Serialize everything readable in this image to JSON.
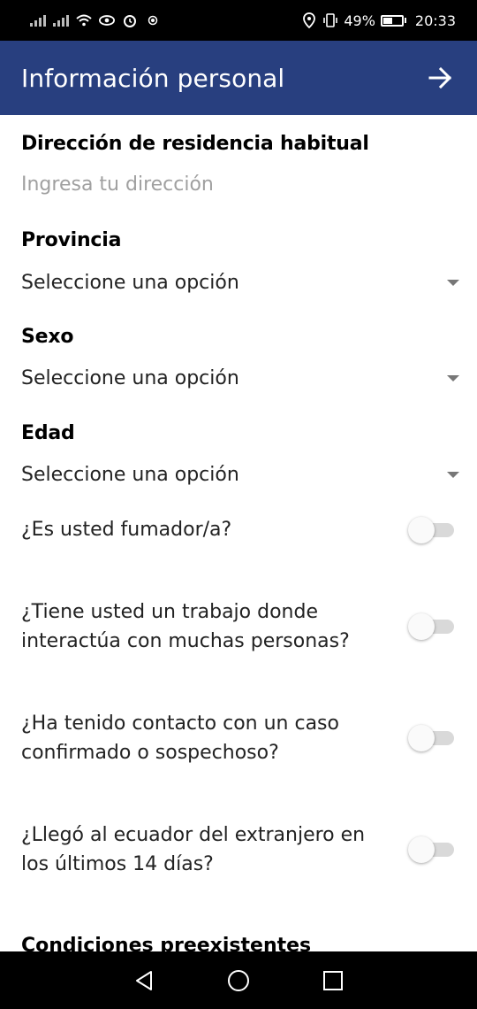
{
  "status_bar": {
    "battery": "49%",
    "time": "20:33",
    "icons": [
      "signal-icon",
      "signal-2-icon",
      "wifi-icon",
      "eye-icon",
      "alarm-icon",
      "sensor-icon",
      "location-icon",
      "vibrate-icon",
      "battery-icon"
    ]
  },
  "app_bar": {
    "title": "Información personal",
    "action_icon": "arrow-right-icon",
    "color": "#283f7f"
  },
  "form": {
    "address": {
      "label": "Dirección de residencia habitual",
      "placeholder": "Ingresa tu dirección",
      "value": ""
    },
    "province": {
      "label": "Provincia",
      "value": "Seleccione una opción"
    },
    "sex": {
      "label": "Sexo",
      "value": "Seleccione una opción"
    },
    "age": {
      "label": "Edad",
      "value": "Seleccione una opción"
    },
    "questions": [
      {
        "text": "¿Es usted fumador/a?",
        "checked": false
      },
      {
        "text": "¿Tiene usted un trabajo donde interactúa con muchas personas?",
        "checked": false
      },
      {
        "text": "¿Ha tenido contacto con un caso confirmado o sospechoso?",
        "checked": false
      },
      {
        "text": "¿Llegó al ecuador del extranjero en los últimos 14 días?",
        "checked": false
      }
    ],
    "next_section": "Condiciones preexistentes"
  },
  "nav_bar": {
    "icons": [
      "back-icon",
      "home-icon",
      "recents-icon"
    ]
  }
}
